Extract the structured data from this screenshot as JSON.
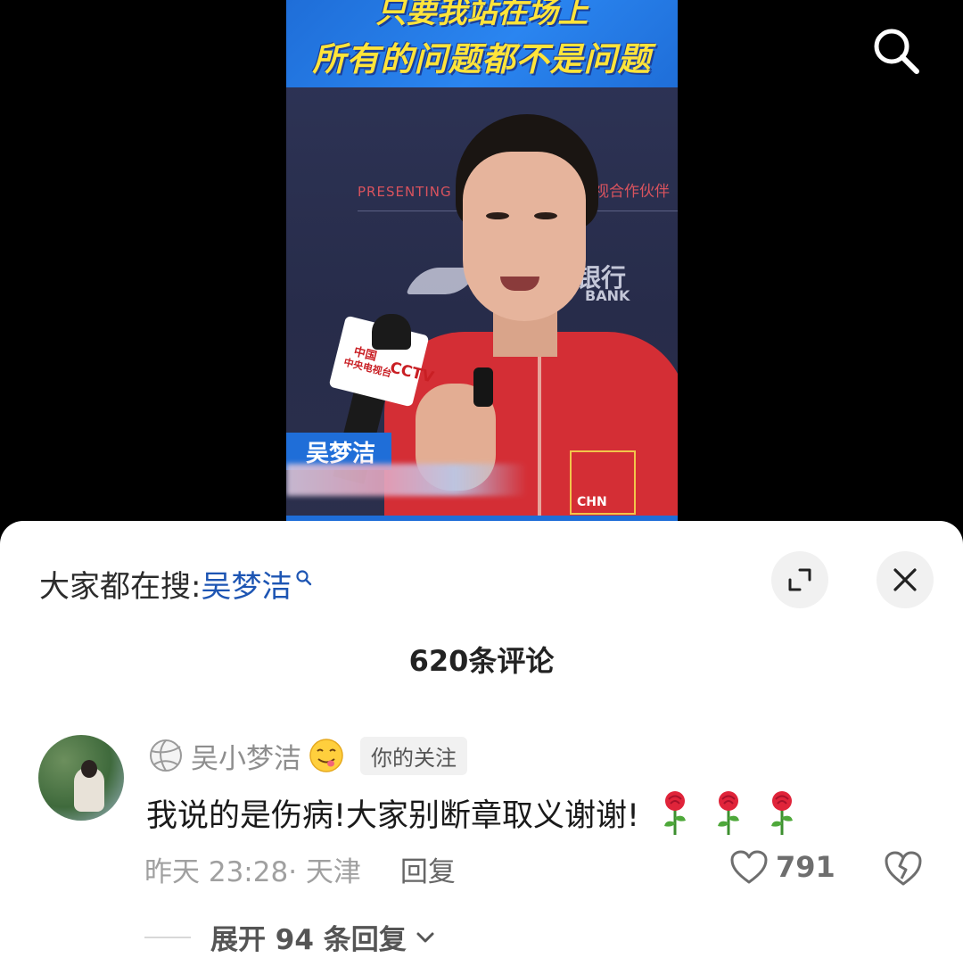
{
  "video": {
    "banner_line1": "只要我站在场上",
    "banner_line2": "所有的问题都不是问题",
    "bg_text_left": "PRESENTING",
    "bg_text_right": "视合作伙伴",
    "bg_bank_top": "银行",
    "bg_bank_bottom": "BANK",
    "mic_text_top": "中国",
    "mic_text_bottom": "中央电视台",
    "mic_logo": "CCTV",
    "flag_text": "CHN",
    "name_plate": "吴梦洁"
  },
  "top_bar": {
    "search_icon": "search-icon"
  },
  "sheet": {
    "hot_search_label": "大家都在搜:",
    "hot_search_term": "吴梦洁",
    "comment_count": "620条评论",
    "expand_icon": "expand-icon",
    "close_icon": "close-icon"
  },
  "comment": {
    "username": "吴小梦洁",
    "badge": "你的关注",
    "text": "我说的是伤病!大家别断章取义谢谢!",
    "time": "昨天 23:28",
    "location": "· 天津",
    "reply_label": "回复",
    "likes": "791",
    "expand_replies": "展开 94 条回复"
  },
  "colors": {
    "link_blue": "#1d55b3",
    "banner_blue": "#1f6ed8",
    "banner_text": "#ffe43a"
  }
}
